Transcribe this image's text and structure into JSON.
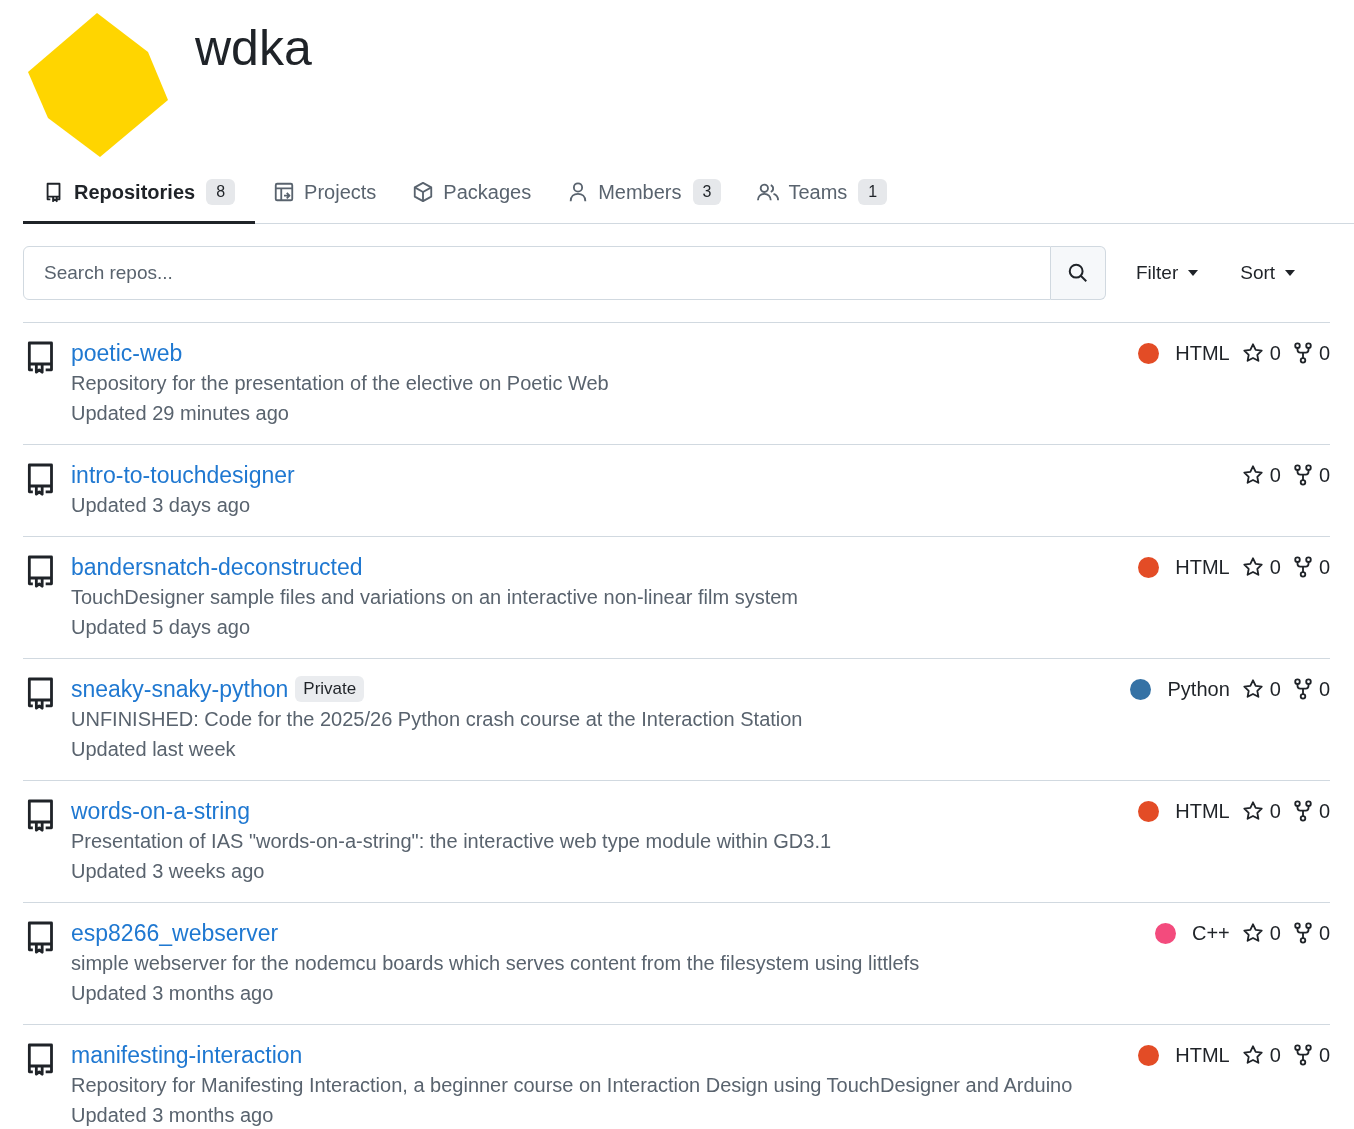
{
  "org": {
    "name": "wdka"
  },
  "tabs": [
    {
      "kind": "repo",
      "label": "Repositories",
      "count": "8",
      "selected": true
    },
    {
      "kind": "project",
      "label": "Projects",
      "selected": false
    },
    {
      "kind": "package",
      "label": "Packages",
      "selected": false
    },
    {
      "kind": "person",
      "label": "Members",
      "count": "3",
      "selected": false
    },
    {
      "kind": "people",
      "label": "Teams",
      "count": "1",
      "selected": false
    }
  ],
  "search": {
    "placeholder": "Search repos..."
  },
  "menus": [
    "Filter",
    "Sort"
  ],
  "repos": [
    {
      "name": "poetic-web",
      "description": "Repository for the presentation of the elective on Poetic Web",
      "updated": "Updated 29 minutes ago",
      "language": "HTML",
      "color": "#e34c26",
      "stars": "0",
      "forks": "0"
    },
    {
      "name": "intro-to-touchdesigner",
      "updated": "Updated 3 days ago",
      "stars": "0",
      "forks": "0"
    },
    {
      "name": "bandersnatch-deconstructed",
      "description": "TouchDesigner sample files and variations on an interactive non-linear film system",
      "updated": "Updated 5 days ago",
      "language": "HTML",
      "color": "#e34c26",
      "stars": "0",
      "forks": "0"
    },
    {
      "name": "sneaky-snaky-python",
      "badge": "Private",
      "description": "UNFINISHED: Code for the 2025/26 Python crash course at the Interaction Station",
      "updated": "Updated last week",
      "language": "Python",
      "color": "#3572a5",
      "stars": "0",
      "forks": "0"
    },
    {
      "name": "words-on-a-string",
      "description": "Presentation of IAS \"words-on-a-string\": the interactive web type module within GD3.1",
      "updated": "Updated 3 weeks ago",
      "language": "HTML",
      "color": "#e34c26",
      "stars": "0",
      "forks": "0"
    },
    {
      "name": "esp8266_webserver",
      "description": "simple webserver for the nodemcu boards which serves content from the filesystem using littlefs",
      "updated": "Updated 3 months ago",
      "language": "C++",
      "color": "#f34b7d",
      "stars": "0",
      "forks": "0"
    },
    {
      "name": "manifesting-interaction",
      "description": "Repository for Manifesting Interaction, a beginner course on Interaction Design using TouchDesigner and Arduino",
      "updated": "Updated 3 months ago",
      "language": "HTML",
      "color": "#e34c26",
      "stars": "0",
      "forks": "0"
    }
  ]
}
